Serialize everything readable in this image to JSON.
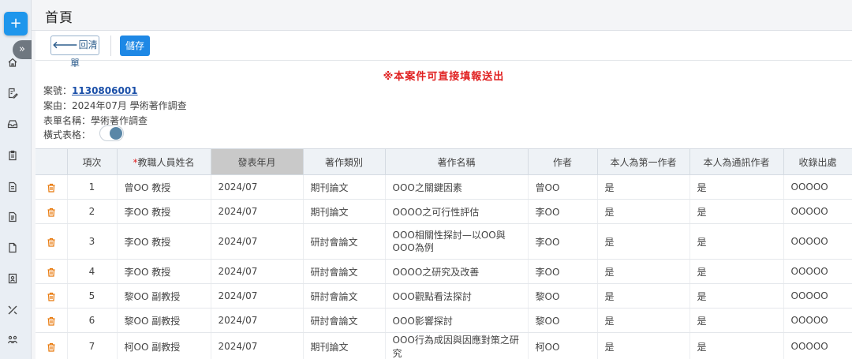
{
  "header": {
    "title": "首頁"
  },
  "rail": {
    "add_label": "+",
    "expand_label": "»",
    "icons": [
      "home-icon",
      "edit-document-icon",
      "inbox-icon",
      "clipboard-icon",
      "document-icon",
      "document-lines-icon",
      "file-icon",
      "contact-card-icon",
      "tools-icon",
      "people-icon"
    ]
  },
  "toolbar": {
    "back_label": "回清單",
    "back_arrow": "🡐",
    "save_label": "儲存"
  },
  "notice": "※本案件可直接填報送出",
  "info": {
    "case_no_label": "案號：",
    "case_no": "1130806001",
    "subject_label": "案由：",
    "subject": "2024年07月 學術著作調查",
    "form_name_label": "表單名稱：",
    "form_name": "學術著作調查",
    "landscape_label": "橫式表格："
  },
  "table": {
    "columns": [
      "",
      "項次",
      "教職人員姓名",
      "發表年月",
      "著作類別",
      "著作名稱",
      "作者",
      "本人為第一作者",
      "本人為通訊作者",
      "收錄出處"
    ],
    "required_col": 2,
    "sorted_col": 3,
    "rows": [
      {
        "no": "1",
        "name": "曾OO 教授",
        "date": "2024/07",
        "type": "期刊論文",
        "title": "OOO之關鍵因素",
        "author": "曾OO",
        "first": "是",
        "corr": "是",
        "source": "OOOOO"
      },
      {
        "no": "2",
        "name": "李OO 教授",
        "date": "2024/07",
        "type": "期刊論文",
        "title": "OOOO之可行性評估",
        "author": "李OO",
        "first": "是",
        "corr": "是",
        "source": "OOOOO"
      },
      {
        "no": "3",
        "name": "李OO 教授",
        "date": "2024/07",
        "type": "研討會論文",
        "title": "OOO相關性探討—以OO與OOO為例",
        "author": "李OO",
        "first": "是",
        "corr": "是",
        "source": "OOOOO"
      },
      {
        "no": "4",
        "name": "李OO 教授",
        "date": "2024/07",
        "type": "研討會論文",
        "title": "OOOO之研究及改善",
        "author": "李OO",
        "first": "是",
        "corr": "是",
        "source": "OOOOO"
      },
      {
        "no": "5",
        "name": "黎OO 副教授",
        "date": "2024/07",
        "type": "研討會論文",
        "title": "OOO觀點看法探討",
        "author": "黎OO",
        "first": "是",
        "corr": "是",
        "source": "OOOOO"
      },
      {
        "no": "6",
        "name": "黎OO 副教授",
        "date": "2024/07",
        "type": "研討會論文",
        "title": "OOO影響探討",
        "author": "黎OO",
        "first": "是",
        "corr": "是",
        "source": "OOOOO"
      },
      {
        "no": "7",
        "name": "柯OO 副教授",
        "date": "2024/07",
        "type": "期刊論文",
        "title": "OOO行為成因與因應對策之研究",
        "author": "柯OO",
        "first": "是",
        "corr": "是",
        "source": "OOOOO"
      }
    ]
  },
  "colors": {
    "accent": "#1e88e5",
    "notice": "#e02020",
    "delete_icon": "#e8790c",
    "toggle_knob": "#5a87a7"
  }
}
